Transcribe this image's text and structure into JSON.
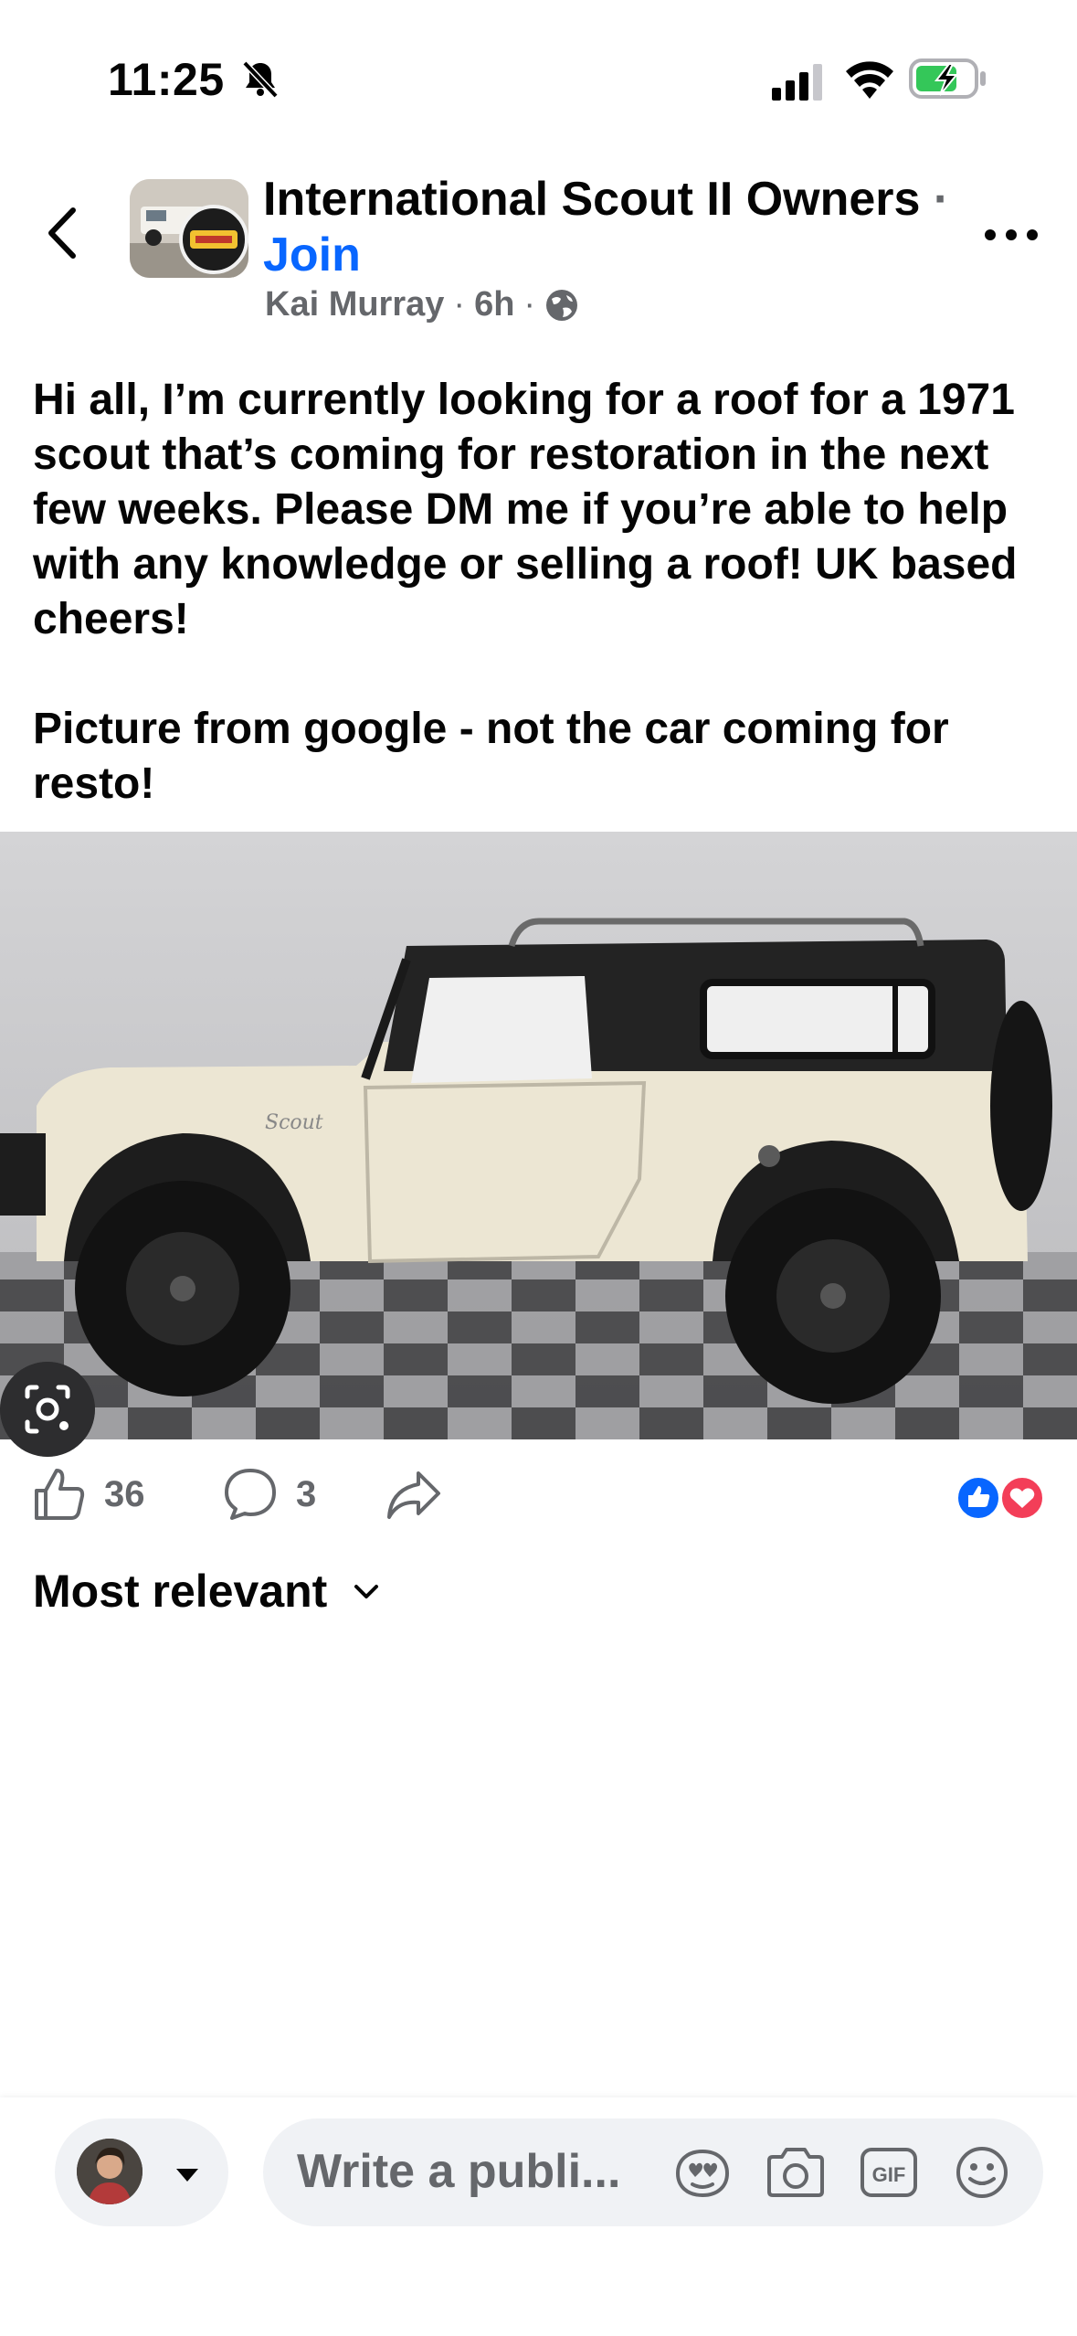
{
  "status_bar": {
    "time": "11:25",
    "icons": [
      "bell-off-icon",
      "signal-icon",
      "wifi-icon",
      "battery-charging-icon"
    ]
  },
  "header": {
    "group_name": "International Scout II Owners",
    "separator": "·",
    "join_label": "Join",
    "author": "Kai Murray",
    "time_ago": "6h",
    "privacy_icon": "globe-icon"
  },
  "post": {
    "text": "Hi all, I’m currently looking for a roof for a 1971 scout that’s coming for restoration in the next few weeks. Please DM me if you’re able to help with any knowledge or selling a roof! UK based cheers!\n\nPicture from google - not the car coming for resto!"
  },
  "actions": {
    "like_count": "36",
    "comment_count": "3",
    "reactions": [
      "like-reaction-icon",
      "love-reaction-icon"
    ],
    "colors": {
      "like": "#0866ff",
      "love": "#f33e58"
    }
  },
  "comments": {
    "sort_label": "Most relevant"
  },
  "composer": {
    "placeholder": "Write a publi...",
    "icons": [
      "avatar-sticker-icon",
      "camera-icon",
      "gif-icon",
      "emoji-icon"
    ]
  },
  "colors": {
    "accent": "#0866ff",
    "secondary_text": "#65676b",
    "input_bg": "#f0f2f5"
  }
}
